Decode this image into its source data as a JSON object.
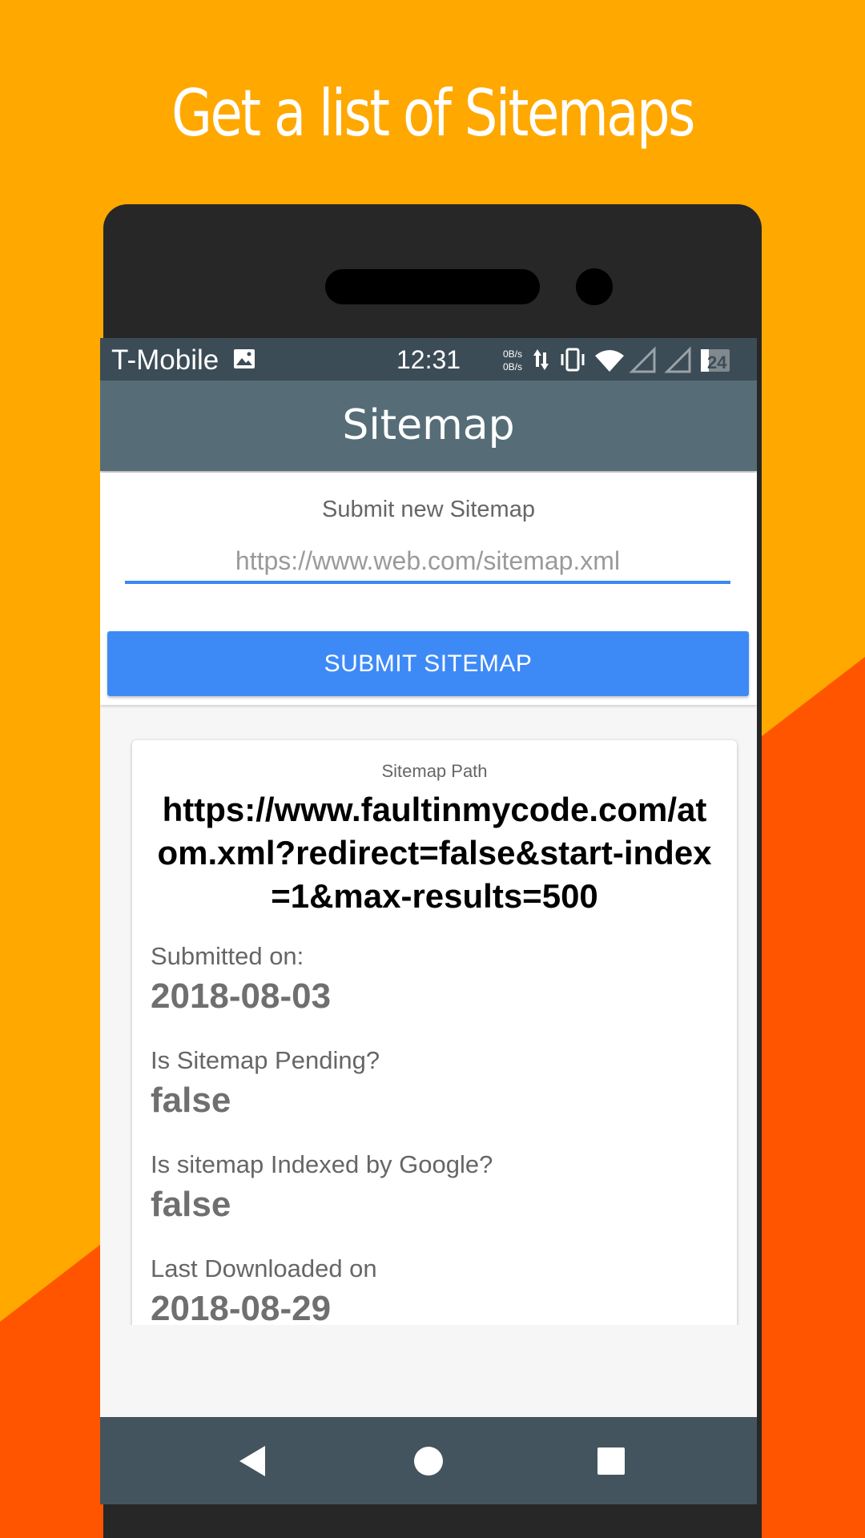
{
  "promo": {
    "title": "Get a list of Sitemaps"
  },
  "status_bar": {
    "carrier": "T-Mobile",
    "time": "12:31",
    "net_up": "0B/s",
    "net_down": "0B/s",
    "battery": "24"
  },
  "app_bar": {
    "title": "Sitemap"
  },
  "submit": {
    "label": "Submit new Sitemap",
    "placeholder": "https://www.web.com/sitemap.xml",
    "button_label": "SUBMIT SITEMAP"
  },
  "sitemap": {
    "path_label": "Sitemap Path",
    "path": "https://www.faultinmycode.com/atom.xml?redirect=false&start-index=1&max-results=500",
    "fields": [
      {
        "label": "Submitted on:",
        "value": "2018-08-03"
      },
      {
        "label": "Is Sitemap Pending?",
        "value": "false"
      },
      {
        "label": "Is sitemap Indexed by Google?",
        "value": "false"
      },
      {
        "label": "Last Downloaded on",
        "value": "2018-08-29"
      }
    ]
  },
  "colors": {
    "background": "#FFA800",
    "accent_orange": "#FF5500",
    "app_bar": "#566d78",
    "button": "#3d8af7"
  }
}
